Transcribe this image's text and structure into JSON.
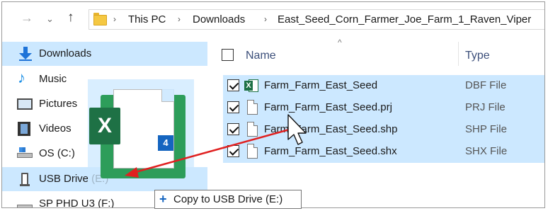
{
  "address_bar": {
    "back": "→",
    "history": "⌄",
    "up": "↑",
    "crumbs": [
      "This PC",
      "Downloads",
      "East_Seed_Corn_Farmer_Joe_Farm_1_Raven_Viper"
    ],
    "separator": "›"
  },
  "nav_pane": {
    "scroll_up": "^",
    "items": [
      {
        "label": "Downloads",
        "icon": "download-arrow-icon",
        "selected": true
      },
      {
        "label": "Music",
        "icon": "music-note-icon",
        "selected": false
      },
      {
        "label": "Pictures",
        "icon": "pictures-icon",
        "selected": false
      },
      {
        "label": "Videos",
        "icon": "film-icon",
        "selected": false
      },
      {
        "label": "OS (C:)",
        "icon": "system-drive-icon",
        "selected": false
      },
      {
        "label": "USB Drive (E:)",
        "icon": "usb-drive-icon",
        "selected": true
      },
      {
        "label": "SP PHD U3 (F:)",
        "icon": "external-drive-icon",
        "selected": false
      }
    ]
  },
  "file_list": {
    "columns": {
      "name": "Name",
      "type": "Type"
    },
    "sort_indicator": "^",
    "files": [
      {
        "name": "Farm_Farm_East_Seed",
        "type": "DBF File",
        "icon": "excel-file-icon",
        "checked": true
      },
      {
        "name": "Farm_Farm_East_Seed.prj",
        "type": "PRJ File",
        "icon": "generic-file-icon",
        "checked": true
      },
      {
        "name": "Farm_Farm_East_Seed.shp",
        "type": "SHP File",
        "icon": "generic-file-icon",
        "checked": true
      },
      {
        "name": "Farm_Farm_East_Seed.shx",
        "type": "SHX File",
        "icon": "generic-file-icon",
        "checked": true
      }
    ]
  },
  "drag": {
    "count": "4",
    "ghost_icon_letter": "X",
    "tooltip_plus": "+",
    "tooltip": "Copy to USB Drive (E:)"
  },
  "colors": {
    "selection": "#cce8ff",
    "arrow": "#e02020",
    "excel_green": "#1e7145",
    "badge_blue": "#1565c0",
    "folder_yellow": "#f5c842"
  }
}
